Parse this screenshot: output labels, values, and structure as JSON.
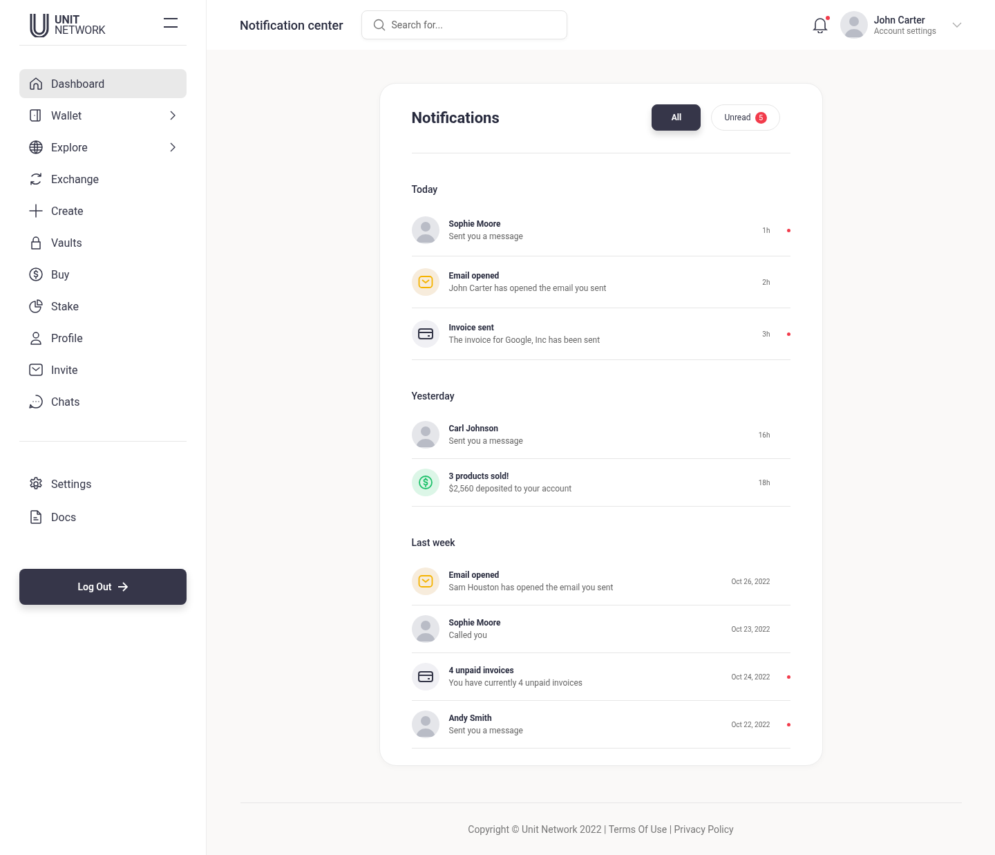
{
  "sidebar": {
    "logo": {
      "line1": "UNIT",
      "line2": "NETWORK"
    },
    "items": [
      {
        "label": "Dashboard",
        "selected": true,
        "has_submenu": false
      },
      {
        "label": "Wallet",
        "selected": false,
        "has_submenu": true
      },
      {
        "label": "Explore",
        "selected": false,
        "has_submenu": true
      },
      {
        "label": "Exchange",
        "selected": false,
        "has_submenu": false
      },
      {
        "label": "Create",
        "selected": false,
        "has_submenu": false
      },
      {
        "label": "Vaults",
        "selected": false,
        "has_submenu": false
      },
      {
        "label": "Buy",
        "selected": false,
        "has_submenu": false
      },
      {
        "label": "Stake",
        "selected": false,
        "has_submenu": false
      },
      {
        "label": "Profile",
        "selected": false,
        "has_submenu": false
      },
      {
        "label": "Invite",
        "selected": false,
        "has_submenu": false
      },
      {
        "label": "Chats",
        "selected": false,
        "has_submenu": false
      }
    ],
    "bottom_items": [
      {
        "label": "Settings",
        "selected": false
      },
      {
        "label": "Docs",
        "selected": false
      }
    ],
    "logout": "Log Out"
  },
  "header": {
    "title": "Notification center",
    "search": {
      "placeholder": "Search for..."
    },
    "bell_unread": true,
    "user": {
      "name": "John Carter",
      "subtitle": "Account settings"
    }
  },
  "notifications": {
    "title": "Notifications",
    "filters": [
      {
        "label": "All",
        "selected": true
      },
      {
        "label": "Unread",
        "selected": false,
        "badge": "5"
      }
    ],
    "groups": [
      {
        "label": "Today",
        "items": [
          {
            "kind": "avatar",
            "title": "Sophie Moore",
            "text": "Sent you a message",
            "time": "1h",
            "unread": true
          },
          {
            "kind": "email",
            "title": "Email opened",
            "text": "John Carter has opened the email you sent",
            "time": "2h",
            "unread": false
          },
          {
            "kind": "invoice",
            "title": "Invoice sent",
            "text": "The invoice for Google, Inc has been sent",
            "time": "3h",
            "unread": true
          }
        ]
      },
      {
        "label": "Yesterday",
        "items": [
          {
            "kind": "avatar",
            "title": "Carl Johnson",
            "text": "Sent you a message",
            "time": "16h",
            "unread": false
          },
          {
            "kind": "money",
            "title": "3 products sold!",
            "text": "$2,560 deposited to your account",
            "time": "18h",
            "unread": false
          }
        ]
      },
      {
        "label": "Last week",
        "items": [
          {
            "kind": "email",
            "title": "Email opened",
            "text": "Sam Houston has opened the email you sent",
            "time": "Oct 26, 2022",
            "unread": false
          },
          {
            "kind": "avatar",
            "title": "Sophie Moore",
            "text": "Called you",
            "time": "Oct 23, 2022",
            "unread": false
          },
          {
            "kind": "invoice",
            "title": "4 unpaid invoices",
            "text": "You have currently 4 unpaid invoices",
            "time": "Oct 24, 2022",
            "unread": true
          },
          {
            "kind": "avatar",
            "title": "Andy Smith",
            "text": "Sent you a message",
            "time": "Oct 22, 2022",
            "unread": true
          }
        ]
      }
    ]
  },
  "footer": "Copyright © Unit Network 2022 | Terms Of Use | Privacy Policy"
}
